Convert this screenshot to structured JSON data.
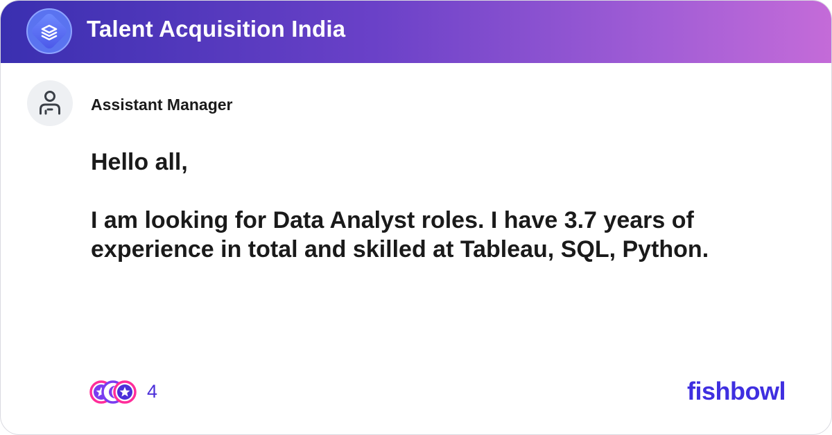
{
  "header": {
    "title": "Talent Acquisition India",
    "logo_icon": "layers-icon"
  },
  "post": {
    "author": "Assistant Manager",
    "avatar_icon": "user-icon",
    "greeting": "Hello all,",
    "message": "I am looking for Data Analyst roles. I have 3.7 years of experience in total and skilled at Tableau, SQL, Python."
  },
  "reactions": {
    "icons": [
      "star-reaction-icon",
      "moon-reaction-icon",
      "star-reaction-icon"
    ],
    "count": "4"
  },
  "brand": {
    "name": "fishbowl"
  },
  "colors": {
    "header_gradient_start": "#3a2fb0",
    "header_gradient_end": "#c46bd8",
    "accent": "#4b2fd9",
    "brand": "#3f2fe0"
  }
}
